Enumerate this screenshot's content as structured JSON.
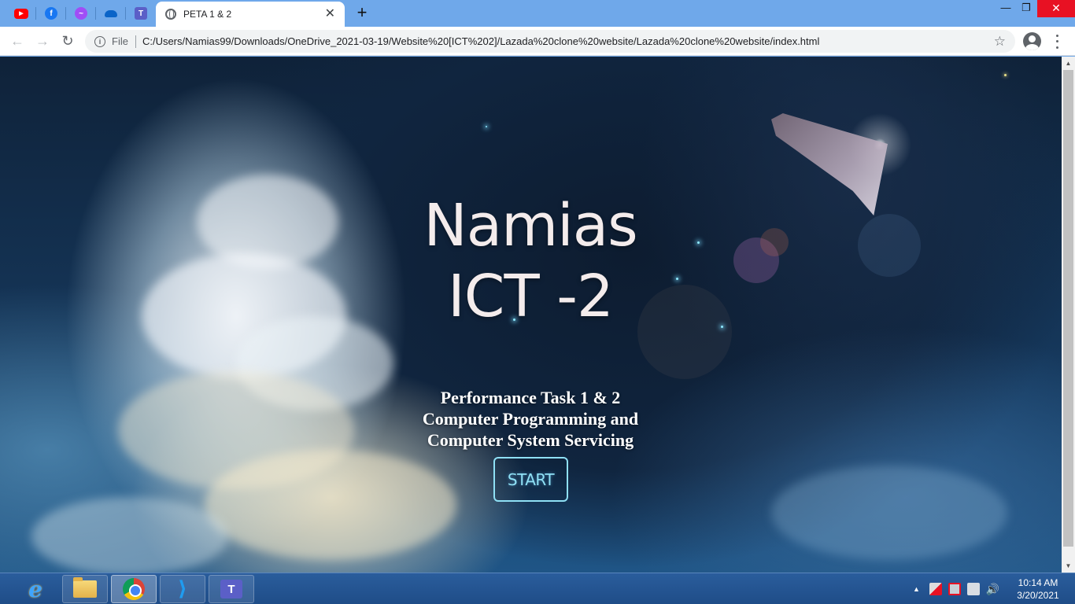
{
  "browser": {
    "pinned_tabs": [
      {
        "icon": "youtube-icon"
      },
      {
        "icon": "facebook-icon"
      },
      {
        "icon": "messenger-icon"
      },
      {
        "icon": "onedrive-icon"
      },
      {
        "icon": "teams-icon"
      }
    ],
    "active_tab": {
      "title": "PETA 1 & 2",
      "close_glyph": "✕"
    },
    "new_tab_glyph": "+",
    "window": {
      "minimize": "—",
      "restore": "❐",
      "close": "✕"
    },
    "nav": {
      "back": "←",
      "forward": "→",
      "reload": "↻"
    },
    "omnibox": {
      "info_glyph": "i",
      "scheme": "File",
      "url": "C:/Users/Namias99/Downloads/OneDrive_2021-03-19/Website%20[ICT%202]/Lazada%20clone%20website/Lazada%20clone%20website/index.html",
      "star_glyph": "☆"
    }
  },
  "page": {
    "title_line1": "Namias",
    "title_line2": "ICT -2",
    "subtitle_line1": "Performance Task 1 & 2",
    "subtitle_line2": "Computer Programming and",
    "subtitle_line3": "Computer System Servicing",
    "start_label": "START",
    "accent": "#8fe0f5"
  },
  "scrollbar": {
    "up": "▲",
    "down": "▼"
  },
  "taskbar": {
    "apps": [
      "internet-explorer-icon",
      "file-explorer-icon",
      "chrome-icon",
      "vscode-icon",
      "teams-icon"
    ],
    "teams_letter": "T",
    "tray_arrow": "▲",
    "clock": {
      "time": "10:14 AM",
      "date": "3/20/2021"
    }
  }
}
